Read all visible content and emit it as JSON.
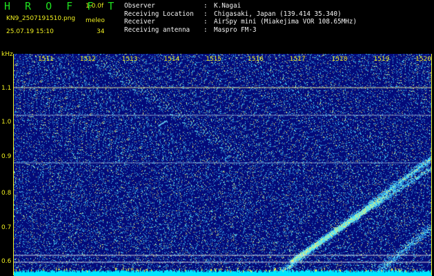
{
  "header": {
    "app_title": "H R O F F T",
    "version": "1.0.0f",
    "filename": "KN9_2507191510.png",
    "meleo_label": "meleo",
    "datetime": "25.07.19 15:10",
    "count": "34"
  },
  "metadata": [
    {
      "key": "Observer",
      "sep": ":",
      "value": "K.Nagai"
    },
    {
      "key": "Receiving Location",
      "sep": ":",
      "value": "Chigasaki, Japan (139.414 35.340)"
    },
    {
      "key": "Receiver",
      "sep": ":",
      "value": "AirSpy mini (Miakejima VOR 108.65MHz)"
    },
    {
      "key": "Receiving antenna",
      "sep": ":",
      "value": "Maspro FM-3"
    }
  ],
  "chart_data": {
    "type": "heatmap",
    "y_unit_label": "kHz",
    "y_ticks": [
      "1.1",
      "1.0",
      "0.9",
      "0.8",
      "0.7",
      "0.6"
    ],
    "x_ticks": [
      "1511",
      "1512",
      "1513",
      "1514",
      "1515",
      "1516",
      "1517",
      "1518",
      "1519",
      "1520"
    ],
    "colors": {
      "background": "#040a7a",
      "label": "#f0f020",
      "title": "#1fe01f",
      "band": "#00e6ff"
    }
  }
}
